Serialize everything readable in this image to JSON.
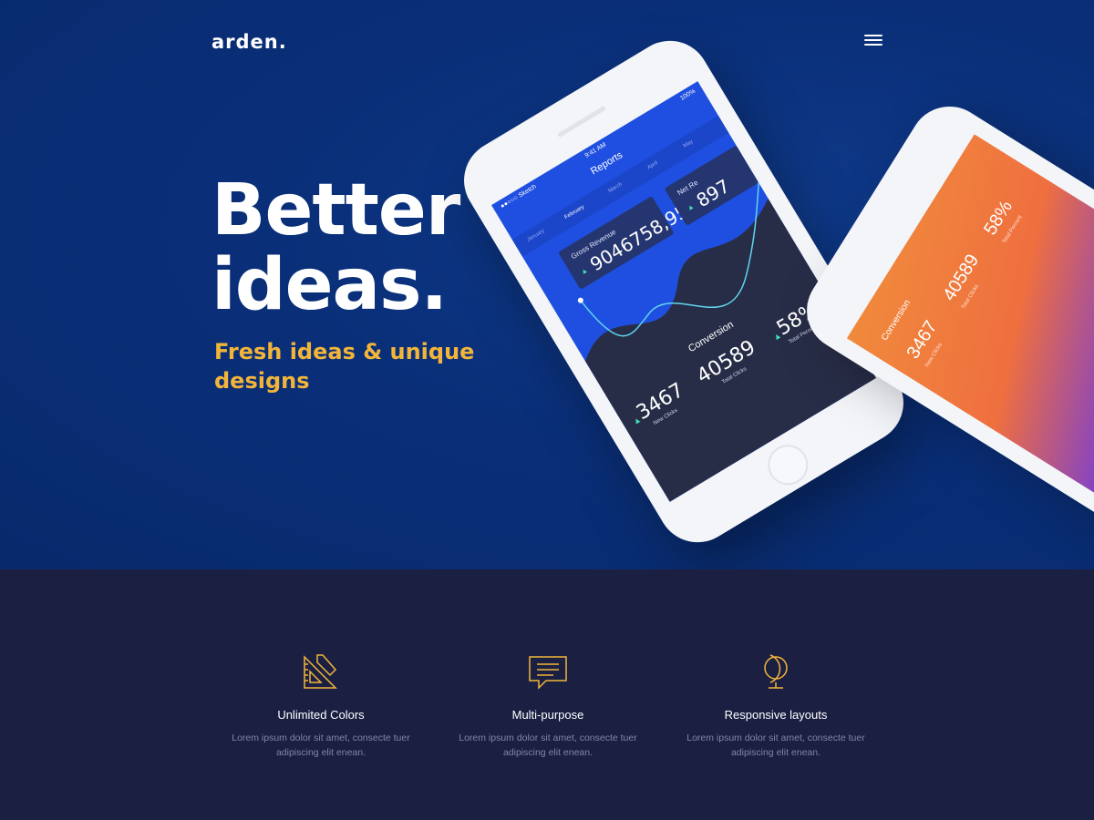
{
  "brand": {
    "logo": "arden."
  },
  "hero": {
    "headline_line1": "Better",
    "headline_line2": "ideas.",
    "tagline": "Fresh ideas & unique designs"
  },
  "phone_main": {
    "status_carrier": "●●○○○ Sketch",
    "status_time": "9:41 AM",
    "status_battery": "100%",
    "app_title": "Reports",
    "months": [
      "January",
      "February",
      "March",
      "April",
      "May"
    ],
    "active_month": "February",
    "gross_revenue_label": "Gross Revenue",
    "gross_revenue_value": "9046758,95",
    "net_label": "Net Re",
    "net_value": "897",
    "conversion_title": "Conversion",
    "stats": [
      {
        "value": "3467",
        "caption": "New Clicks"
      },
      {
        "value": "40589",
        "caption": "Total Clicks"
      },
      {
        "value": "58%",
        "caption": "Total Percent"
      }
    ]
  },
  "phone_second": {
    "title": "Conversion",
    "stats": [
      {
        "value": "3467",
        "caption": "New Clicks"
      },
      {
        "value": "40589",
        "caption": "Total Clicks"
      },
      {
        "value": "58%",
        "caption": "Total Percent"
      }
    ]
  },
  "features": [
    {
      "icon": "ruler-pencil-icon",
      "title": "Unlimited Colors",
      "desc": "Lorem ipsum dolor sit amet, consecte tuer adipiscing elit enean."
    },
    {
      "icon": "speech-bubble-icon",
      "title": "Multi-purpose",
      "desc": "Lorem ipsum dolor sit amet, consecte tuer adipiscing elit enean."
    },
    {
      "icon": "globe-icon",
      "title": "Responsive layouts",
      "desc": "Lorem ipsum dolor sit amet, consecte tuer adipiscing elit enean."
    }
  ],
  "colors": {
    "hero_bg": "#0a2f79",
    "features_bg": "#1b2043",
    "accent": "#f2b53a",
    "screen_blue": "#1f4fe0"
  }
}
